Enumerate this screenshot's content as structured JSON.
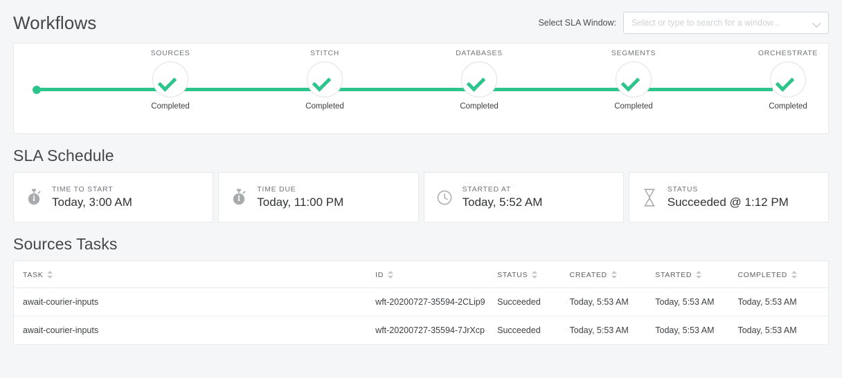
{
  "header": {
    "title": "Workflows",
    "sla_select_label": "Select SLA Window:",
    "sla_select_placeholder": "Select or type to search for a window...",
    "chevron_icon": "chevron-down-icon"
  },
  "stepper": {
    "steps": [
      {
        "name": "SOURCES",
        "status": "Completed",
        "icon": "check-icon"
      },
      {
        "name": "STITCH",
        "status": "Completed",
        "icon": "check-icon"
      },
      {
        "name": "DATABASES",
        "status": "Completed",
        "icon": "check-icon"
      },
      {
        "name": "SEGMENTS",
        "status": "Completed",
        "icon": "check-icon"
      },
      {
        "name": "ORCHESTRATE",
        "status": "Completed",
        "icon": "check-icon"
      }
    ],
    "line_color": "#2ec58d",
    "check_color": "#2ec58d"
  },
  "sla_schedule": {
    "title": "SLA Schedule",
    "cards": [
      {
        "label": "TIME TO START",
        "value": "Today, 3:00 AM",
        "icon": "stopwatch-icon"
      },
      {
        "label": "TIME DUE",
        "value": "Today, 11:00 PM",
        "icon": "stopwatch-icon"
      },
      {
        "label": "STARTED AT",
        "value": "Today, 5:52 AM",
        "icon": "clock-icon"
      },
      {
        "label": "STATUS",
        "value": "Succeeded @ 1:12 PM",
        "icon": "hourglass-icon"
      }
    ]
  },
  "tasks": {
    "title": "Sources Tasks",
    "columns": [
      {
        "label": "TASK",
        "sortable": true
      },
      {
        "label": "ID",
        "sortable": true
      },
      {
        "label": "STATUS",
        "sortable": true
      },
      {
        "label": "CREATED",
        "sortable": true
      },
      {
        "label": "STARTED",
        "sortable": true
      },
      {
        "label": "COMPLETED",
        "sortable": true
      }
    ],
    "rows": [
      {
        "task": "await-courier-inputs",
        "id": "wft-20200727-35594-2CLip9",
        "status": "Succeeded",
        "created": "Today, 5:53 AM",
        "started": "Today, 5:53 AM",
        "completed": "Today, 5:53 AM"
      },
      {
        "task": "await-courier-inputs",
        "id": "wft-20200727-35594-7JrXcp",
        "status": "Succeeded",
        "created": "Today, 5:53 AM",
        "started": "Today, 5:53 AM",
        "completed": "Today, 5:53 AM"
      }
    ]
  },
  "colors": {
    "page_background": "#f4f6f7",
    "card_background": "#ffffff",
    "accent_green": "#2ec58d",
    "border": "#e6e8ea",
    "text_primary": "#3c4043",
    "text_muted": "#70757a"
  }
}
